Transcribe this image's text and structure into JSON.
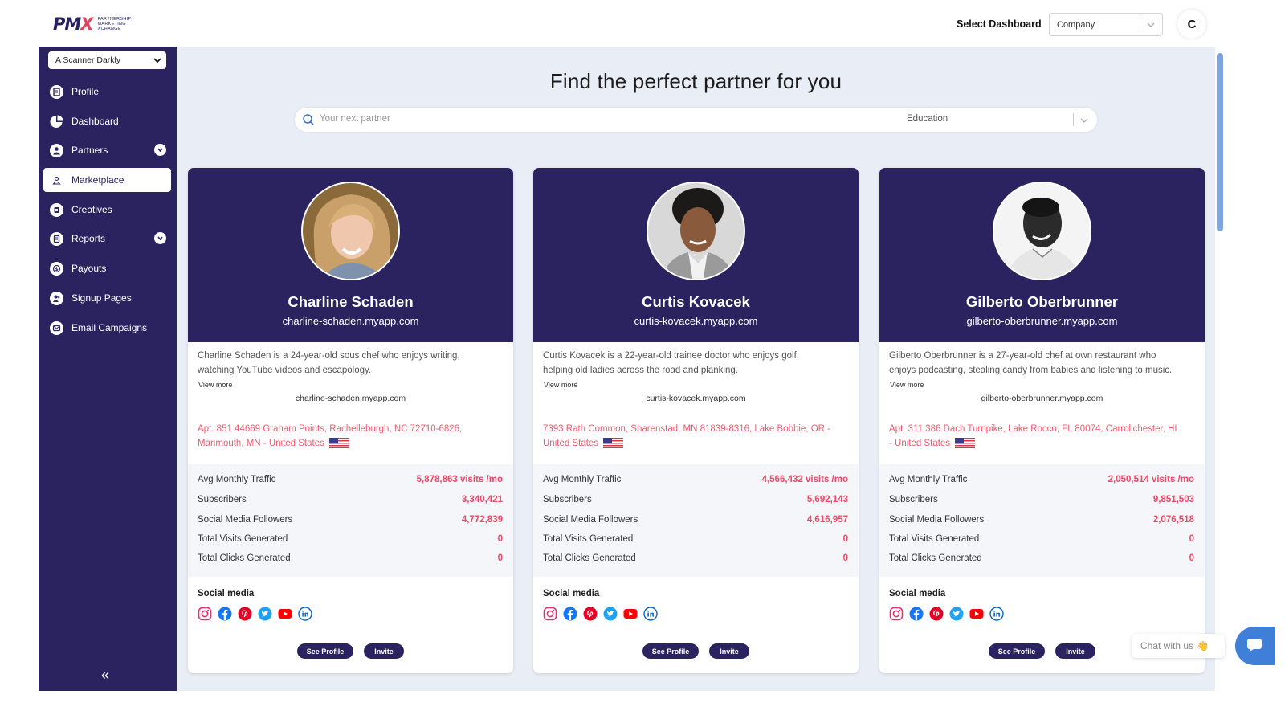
{
  "brand": {
    "logo": "PM",
    "logo_x": "X",
    "tagline": [
      "PARTNERSHIP",
      "MARKETING",
      "XCHANGE"
    ]
  },
  "header": {
    "select_label": "Select Dashboard",
    "select_value": "Company",
    "user_initial": "C"
  },
  "sidebar": {
    "account": "A Scanner Darkly",
    "items": [
      {
        "label": "Profile",
        "icon": "profile-icon"
      },
      {
        "label": "Dashboard",
        "icon": "pie-chart-icon"
      },
      {
        "label": "Partners",
        "icon": "user-icon",
        "expandable": true
      },
      {
        "label": "Marketplace",
        "icon": "marketplace-icon",
        "active": true
      },
      {
        "label": "Creatives",
        "icon": "creatives-icon"
      },
      {
        "label": "Reports",
        "icon": "report-icon",
        "expandable": true
      },
      {
        "label": "Payouts",
        "icon": "dollar-icon"
      },
      {
        "label": "Signup Pages",
        "icon": "signup-icon"
      },
      {
        "label": "Email Campaigns",
        "icon": "mail-icon"
      }
    ],
    "collapse": "«"
  },
  "main": {
    "title": "Find the perfect partner for you",
    "search": {
      "placeholder": "Your next partner",
      "category": "Education"
    }
  },
  "stat_labels": {
    "traffic": "Avg Monthly Traffic",
    "subscribers": "Subscribers",
    "followers": "Social Media Followers",
    "visits": "Total Visits Generated",
    "clicks": "Total Clicks Generated"
  },
  "social_label": "Social media",
  "social_icons": [
    "instagram-icon",
    "facebook-icon",
    "pinterest-icon",
    "twitter-icon",
    "youtube-icon",
    "linkedin-icon"
  ],
  "buttons": {
    "see_profile": "See Profile",
    "invite": "Invite"
  },
  "view_more": "View more",
  "cards": [
    {
      "name": "Charline Schaden",
      "site": "charline-schaden.myapp.com",
      "bio_1": "Charline Schaden is a 24-year-old sous chef who enjoys writing,",
      "bio_2": "watching YouTube videos and escapology.",
      "address_1": "Apt. 851 44669 Graham Points, Rachelleburgh, NC 72710-6826,",
      "address_2": "Marimouth, MN - United States",
      "traffic": "5,878,863 visits /mo",
      "subscribers": "3,340,421",
      "followers": "4,772,839",
      "visits": "0",
      "clicks": "0"
    },
    {
      "name": "Curtis Kovacek",
      "site": "curtis-kovacek.myapp.com",
      "bio_1": "Curtis Kovacek is a 22-year-old trainee doctor who enjoys golf,",
      "bio_2": "helping old ladies across the road and planking.",
      "address_1": "7393 Rath Common, Sharenstad, MN 81839-8316, Lake Bobbie, OR -",
      "address_2": "United States",
      "traffic": "4,566,432 visits /mo",
      "subscribers": "5,692,143",
      "followers": "4,616,957",
      "visits": "0",
      "clicks": "0"
    },
    {
      "name": "Gilberto Oberbrunner",
      "site": "gilberto-oberbrunner.myapp.com",
      "bio_1": "Gilberto Oberbrunner is a 27-year-old chef at own restaurant who",
      "bio_2": "enjoys podcasting, stealing candy from babies and listening to music.",
      "address_1": "Apt. 311 386 Dach Turnpike, Lake Rocco, FL 80074, Carrollchester, HI",
      "address_2": "- United States",
      "traffic": "2,050,514 visits /mo",
      "subscribers": "9,851,503",
      "followers": "2,076,518",
      "visits": "0",
      "clicks": "0"
    }
  ],
  "chat": {
    "label": "Chat with us",
    "emoji": "👋"
  }
}
